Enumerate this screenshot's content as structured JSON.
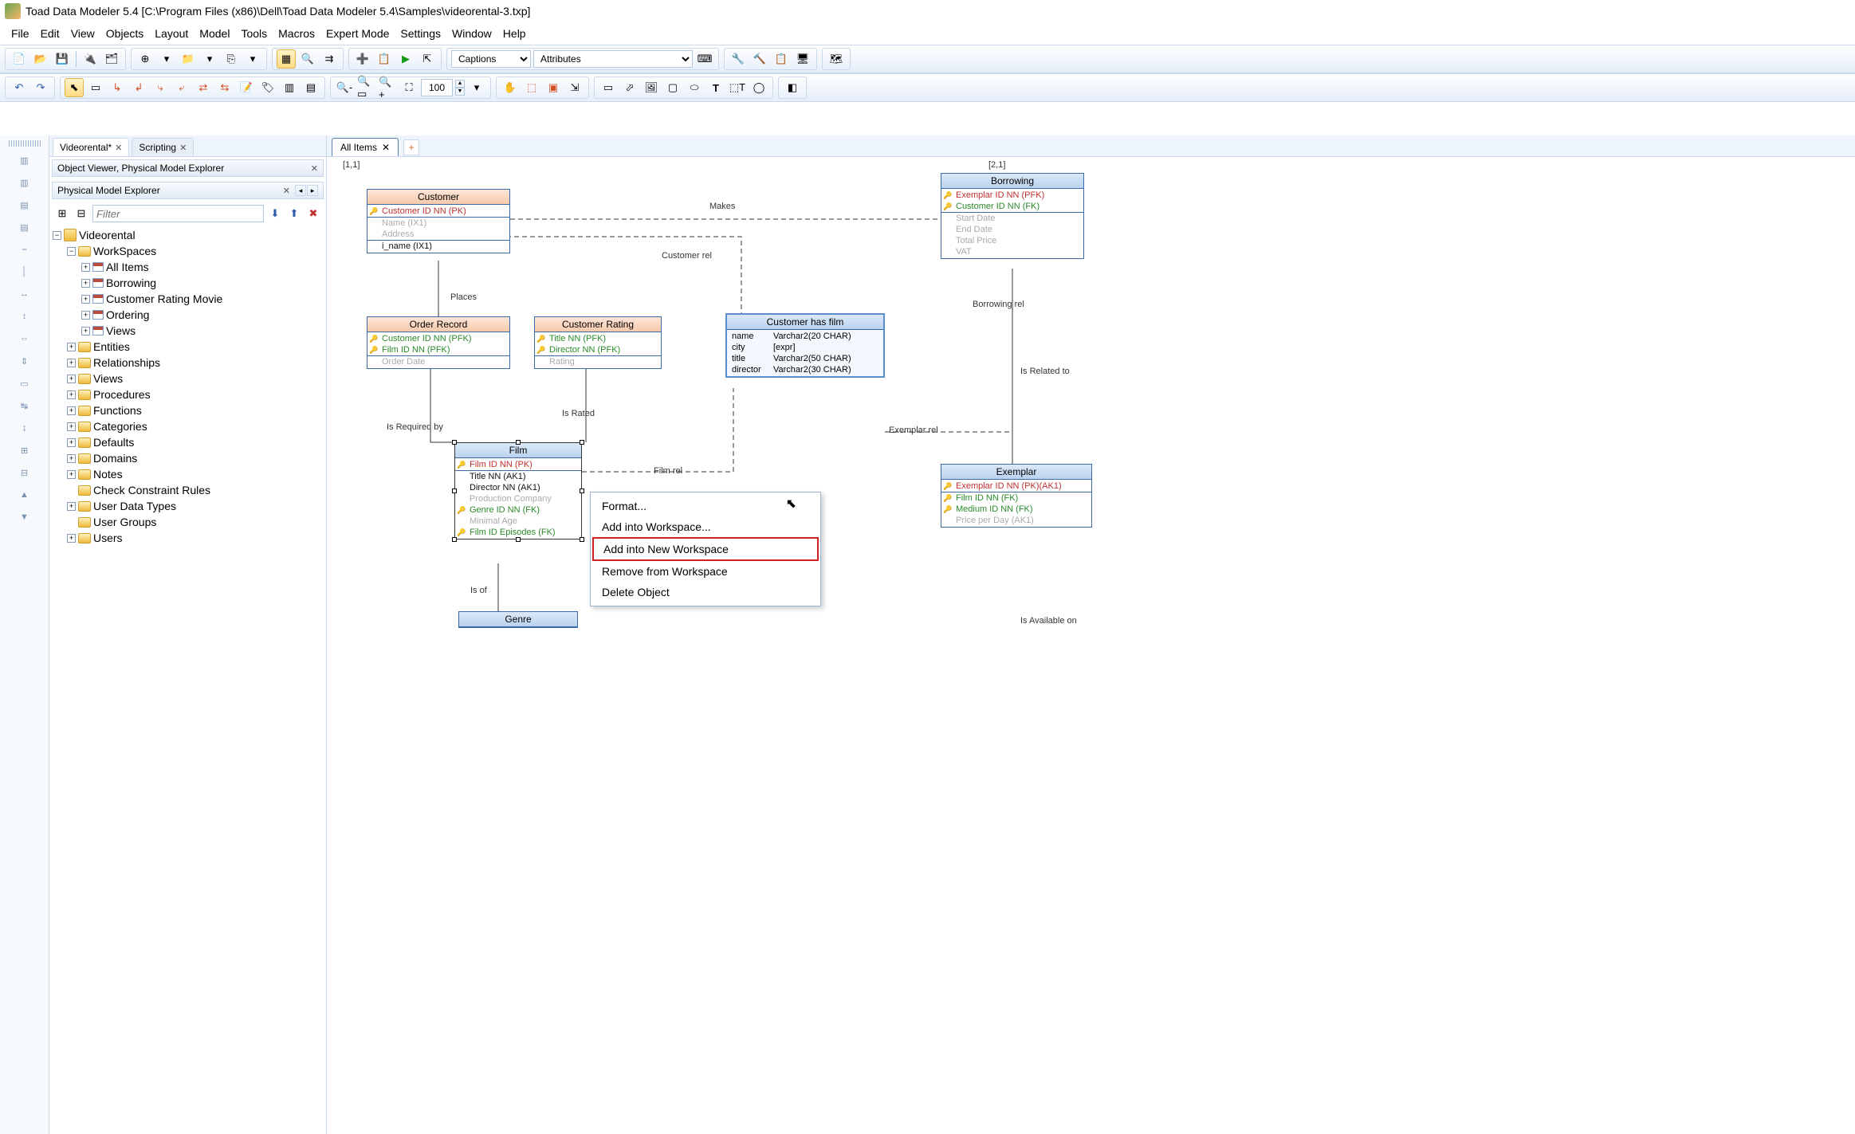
{
  "title": "Toad Data Modeler 5.4  [C:\\Program Files (x86)\\Dell\\Toad Data Modeler 5.4\\Samples\\videorental-3.txp]",
  "menubar": [
    "File",
    "Edit",
    "View",
    "Objects",
    "Layout",
    "Model",
    "Tools",
    "Macros",
    "Expert Mode",
    "Settings",
    "Window",
    "Help"
  ],
  "toolbar": {
    "captions_label": "Captions",
    "attributes_label": "Attributes",
    "zoom_value": "100"
  },
  "doc_tabs": [
    {
      "label": "Videorental*",
      "active": true
    },
    {
      "label": "Scripting",
      "active": false
    }
  ],
  "panel1_title": "Object Viewer, Physical Model Explorer",
  "panel2_title": "Physical Model Explorer",
  "filter_placeholder": "Filter",
  "tree": {
    "root": "Videorental",
    "workspaces": {
      "label": "WorkSpaces",
      "items": [
        "All Items",
        "Borrowing",
        "Customer Rating Movie",
        "Ordering",
        "Views"
      ]
    },
    "nodes": [
      "Entities",
      "Relationships",
      "Views",
      "Procedures",
      "Functions",
      "Categories",
      "Defaults",
      "Domains",
      "Notes",
      "Check Constraint Rules",
      "User Data Types",
      "User Groups",
      "Users"
    ]
  },
  "canvas_tabs": [
    "All Items"
  ],
  "coords": {
    "l": "[1,1]",
    "r": "[2,1]"
  },
  "entities": {
    "customer": {
      "name": "Customer",
      "attrs": [
        {
          "k": "pk",
          "key": "🔑",
          "t": "Customer ID NN  (PK)"
        },
        {
          "k": "ghost",
          "t": "Name  (IX1)"
        },
        {
          "k": "ghost",
          "t": "Address"
        }
      ],
      "idx": "i_name (IX1)"
    },
    "order_record": {
      "name": "Order Record",
      "attrs": [
        {
          "k": "fk",
          "key": "🔑",
          "t": "Customer ID NN  (PFK)"
        },
        {
          "k": "fk",
          "key": "🔑",
          "t": "Film ID NN  (PFK)"
        },
        {
          "k": "ghost",
          "t": "Order Date"
        }
      ]
    },
    "customer_rating": {
      "name": "Customer Rating",
      "attrs": [
        {
          "k": "fk",
          "key": "🔑",
          "t": "Title NN  (PFK)"
        },
        {
          "k": "fk",
          "key": "🔑",
          "t": "Director NN  (PFK)"
        },
        {
          "k": "ghost",
          "t": "Rating"
        }
      ]
    },
    "film": {
      "name": "Film",
      "attrs": [
        {
          "k": "pk",
          "key": "🔑",
          "t": "Film ID NN  (PK)"
        },
        {
          "k": "norm",
          "t": "Title NN (AK1)"
        },
        {
          "k": "norm",
          "t": "Director NN (AK1)"
        },
        {
          "k": "ghost",
          "t": "Production Company"
        },
        {
          "k": "fk",
          "key": "🔑",
          "t": "Genre ID NN  (FK)"
        },
        {
          "k": "ghost",
          "t": "Minimal Age"
        },
        {
          "k": "fk",
          "key": "🔑",
          "t": "Film ID Episodes   (FK)"
        }
      ]
    },
    "genre": {
      "name": "Genre"
    },
    "borrowing": {
      "name": "Borrowing",
      "attrs": [
        {
          "k": "pk",
          "key": "🔑",
          "t": "Exemplar ID NN  (PFK)"
        },
        {
          "k": "fk",
          "key": "🔑",
          "t": "Customer ID NN  (FK)"
        },
        {
          "k": "ghost",
          "t": "Start Date"
        },
        {
          "k": "ghost",
          "t": "End Date"
        },
        {
          "k": "ghost",
          "t": "Total Price"
        },
        {
          "k": "ghost",
          "t": "VAT"
        }
      ]
    },
    "exemplar": {
      "name": "Exemplar",
      "attrs": [
        {
          "k": "pk",
          "key": "🔑",
          "t": "Exemplar ID NN  (PK)(AK1)"
        },
        {
          "k": "fk",
          "key": "🔑",
          "t": "Film ID NN  (FK)"
        },
        {
          "k": "fk",
          "key": "🔑",
          "t": "Medium ID NN  (FK)"
        },
        {
          "k": "ghost",
          "t": "Price per Day  (AK1)"
        }
      ]
    },
    "chf": {
      "name": "Customer has film",
      "rows": [
        [
          "name",
          "Varchar2(20 CHAR)"
        ],
        [
          "city",
          "[expr]"
        ],
        [
          "title",
          "Varchar2(50 CHAR)"
        ],
        [
          "director",
          "Varchar2(30 CHAR)"
        ]
      ]
    }
  },
  "rel_labels": {
    "makes": "Makes",
    "customer_rel": "Customer rel",
    "places": "Places",
    "is_rated": "Is Rated",
    "is_required_by": "Is Required by",
    "film_rel": "Film rel",
    "borrowing_rel": "Borrowing rel",
    "is_related_to": "Is Related to",
    "exemplar_rel": "Exemplar rel",
    "is_of": "Is of",
    "is_available_on": "Is Available on"
  },
  "context_menu": {
    "items": [
      "Format...",
      "Add into Workspace...",
      "Add into New Workspace",
      "Remove from Workspace",
      "Delete Object"
    ],
    "highlighted_index": 2
  }
}
